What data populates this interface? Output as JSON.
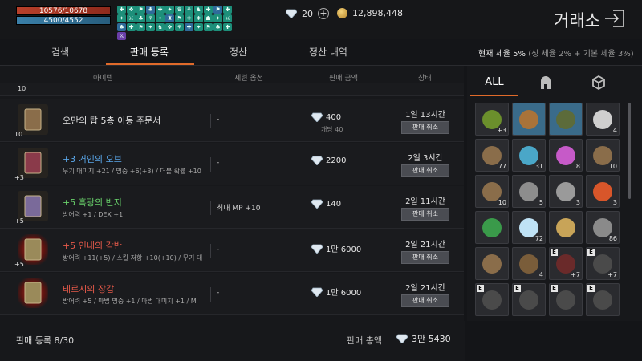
{
  "status": {
    "hp": "10576/10678",
    "mp": "4500/4552"
  },
  "buffs": [
    "✚",
    "❖",
    "⚑",
    "♣",
    "✚",
    "✦",
    "♛",
    "⚘",
    "♞",
    "✚",
    "⚑",
    "✚",
    "✦",
    "⚔",
    "♣",
    "⚘",
    "✦",
    "♜",
    "⚑",
    "✚",
    "❖",
    "☗",
    "✦",
    "⚔",
    "♣",
    "✚",
    "⚑",
    "✦",
    "♞",
    "❖",
    "⚘",
    "✚",
    "✦",
    "⚑",
    "♣",
    "✚",
    "⚔"
  ],
  "currency": {
    "diamonds": "20",
    "gold": "12,898,448"
  },
  "header": {
    "title": "거래소"
  },
  "tabs": [
    {
      "label": "검색"
    },
    {
      "label": "판매 등록"
    },
    {
      "label": "정산"
    },
    {
      "label": "정산 내역"
    }
  ],
  "tax": {
    "label": "현재 세율",
    "rate": "5%",
    "detail": "(성 세율 2% + 기본 세율 3%)"
  },
  "columns": {
    "item": "아이템",
    "option": "제련 옵션",
    "price": "판매 금액",
    "status": "상태"
  },
  "partial_row": {
    "level": "10"
  },
  "listings": [
    {
      "level": "10",
      "name": "오만의 탑 5층 이동 주문서",
      "sub": "",
      "option": "-",
      "price": "400",
      "unit": "개당 40",
      "time": "1일 13시간",
      "button": "판매 취소",
      "color": "#e6e6e6"
    },
    {
      "level": "+3",
      "name": "+3 거인의 오브",
      "sub": "무기 대미지 +21 / 명중 +6(+3) / 더블 확률 +10",
      "option": "-",
      "price": "2200",
      "unit": "",
      "time": "2일 3시간",
      "button": "판매 취소",
      "color": "#5aa7ea"
    },
    {
      "level": "+5",
      "name": "+5 흑광의 반지",
      "sub": "방어력 +1 / DEX +1",
      "option": "최대 MP +10",
      "price": "140",
      "unit": "",
      "time": "2일 11시간",
      "button": "판매 취소",
      "color": "#69d26b"
    },
    {
      "level": "+5",
      "name": "+5 인내의 각반",
      "sub": "방어력 +11(+5) / 스킬 저항 +10(+10) / 무기 대",
      "option": "-",
      "price": "1만 6000",
      "unit": "",
      "time": "2일 21시간",
      "button": "판매 취소",
      "color": "#e85a4a"
    },
    {
      "level": "",
      "name": "테르시의 장갑",
      "sub": "방어력 +5 / 마법 명중 +1 / 마법 대미지 +1 / M",
      "option": "-",
      "price": "1만 6000",
      "unit": "",
      "time": "2일 21시간",
      "button": "판매 취소",
      "color": "#e85a4a"
    }
  ],
  "footer": {
    "registered": "판매 등록 8/30",
    "total_label": "판매 총액",
    "total": "3만 5430"
  },
  "inventory": {
    "tabs": [
      {
        "label": "ALL"
      },
      {
        "label": "helmet-icon"
      },
      {
        "label": "box-icon"
      }
    ],
    "items": [
      {
        "icon": "green-ring",
        "count": "+3",
        "color": "#6b8f2c"
      },
      {
        "icon": "horseshoe",
        "count": "",
        "color": "#a9733a"
      },
      {
        "icon": "green-ore",
        "count": "",
        "color": "#5c6b3a"
      },
      {
        "icon": "white-crystal",
        "count": "4",
        "color": "#cfcfcf"
      },
      {
        "icon": "scroll",
        "count": "77",
        "color": "#8a6d4a"
      },
      {
        "icon": "blue-crystal",
        "count": "31",
        "color": "#4aa7c8"
      },
      {
        "icon": "rainbow-orb",
        "count": "8",
        "color": "#c65ac8"
      },
      {
        "icon": "scroll",
        "count": "10",
        "color": "#8a6d4a"
      },
      {
        "icon": "scroll",
        "count": "10",
        "color": "#8a6d4a"
      },
      {
        "icon": "metal-ingot",
        "count": "5",
        "color": "#8d8d8d"
      },
      {
        "icon": "metal-ingot",
        "count": "3",
        "color": "#9a9a9a"
      },
      {
        "icon": "fire-orb",
        "count": "3",
        "color": "#d8562a"
      },
      {
        "icon": "green-orb",
        "count": "",
        "color": "#3a9a4a"
      },
      {
        "icon": "snowflake",
        "count": "72",
        "color": "#bfe2f5"
      },
      {
        "icon": "gold-coin",
        "count": "",
        "color": "#c8a458"
      },
      {
        "icon": "stone-shard",
        "count": "86",
        "color": "#8a8a8a"
      },
      {
        "icon": "scroll",
        "count": "",
        "color": "#8a6d4a"
      },
      {
        "icon": "scroll",
        "count": "4",
        "color": "#7a5d3a"
      },
      {
        "icon": "dark-armor",
        "count": "+7",
        "color": "#6a2a2a",
        "e": "E"
      },
      {
        "icon": "dark-armor",
        "count": "+7",
        "color": "#4a4a4a",
        "e": "E"
      },
      {
        "icon": "dark-piece",
        "count": "",
        "color": "#4a4a4a",
        "e": "E"
      },
      {
        "icon": "dark-piece",
        "count": "",
        "color": "#4a4a4a",
        "e": "E"
      },
      {
        "icon": "dark-piece",
        "count": "",
        "color": "#4a4a4a",
        "e": "E"
      },
      {
        "icon": "dark-piece",
        "count": "",
        "color": "#4a4a4a",
        "e": "E"
      }
    ]
  }
}
